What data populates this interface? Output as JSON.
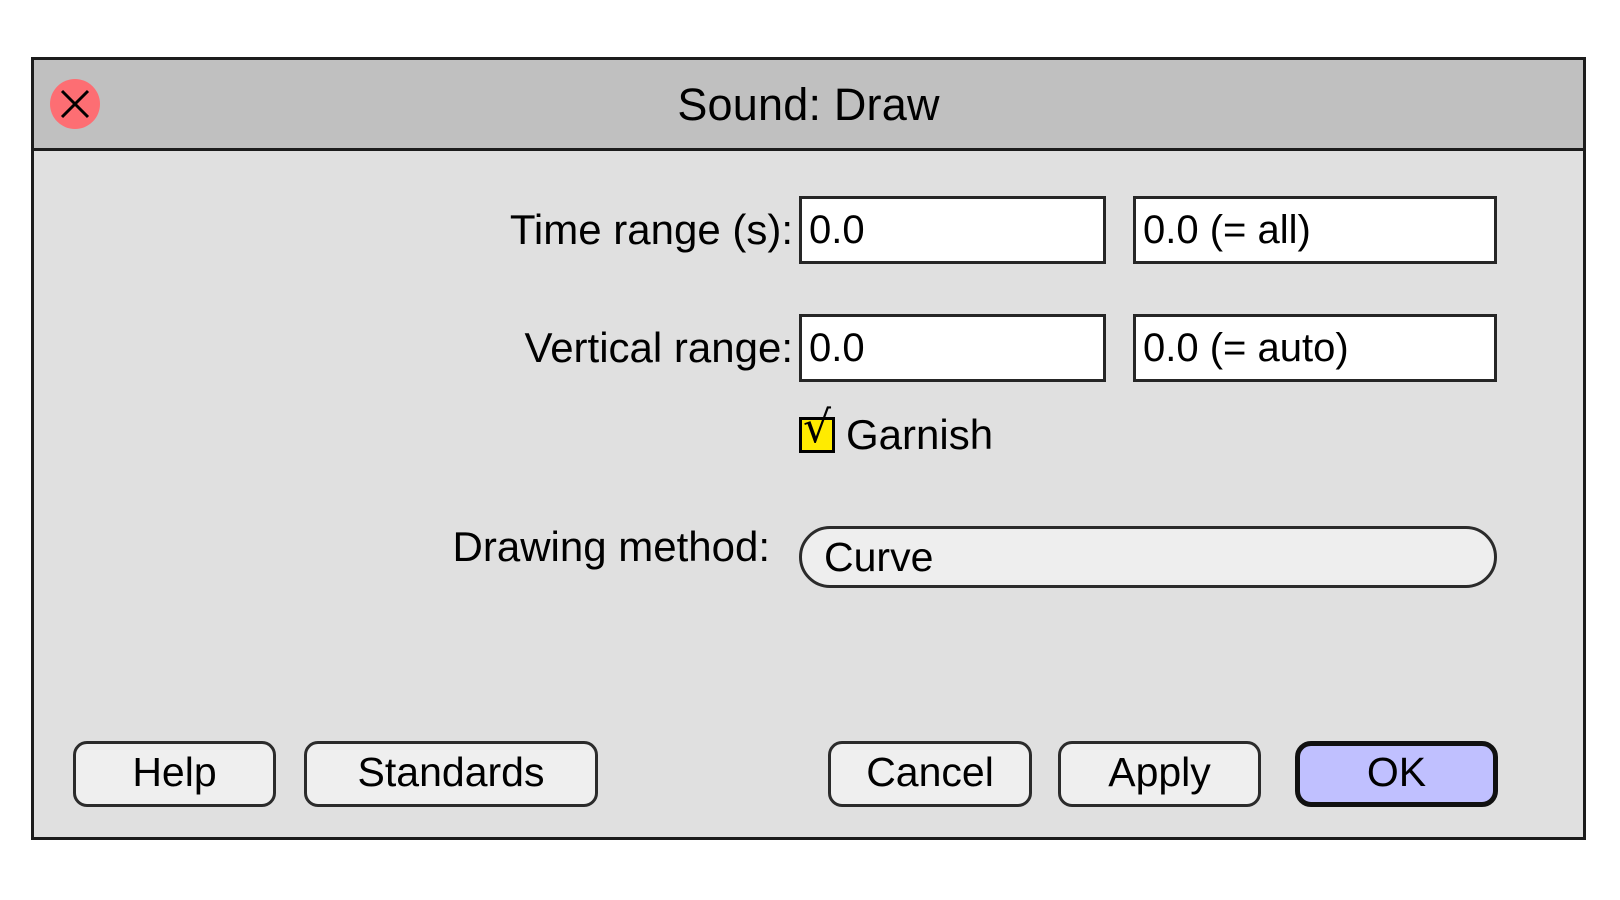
{
  "window": {
    "title": "Sound: Draw",
    "close_icon": "close-x-icon",
    "title_bar_color": "#c0c0c0",
    "body_color": "#e0e0e0",
    "border_color": "#1c1c1c",
    "close_button_color": "#fd6e73"
  },
  "fields": [
    {
      "label": "Time range (s):",
      "from_value": "0.0",
      "to_value": "0.0 (= all)"
    },
    {
      "label": "Vertical range:",
      "from_value": "0.0",
      "to_value": "0.0 (= auto)"
    }
  ],
  "garnish": {
    "label": "Garnish",
    "checked": true,
    "check_glyph": "√",
    "box_color": "#ffeb00"
  },
  "drawing_method": {
    "label": "Drawing method:",
    "value": "Curve"
  },
  "buttons": {
    "help": "Help",
    "standards": "Standards",
    "cancel": "Cancel",
    "apply": "Apply",
    "ok": "OK",
    "ok_color": "#c0c0ff"
  }
}
